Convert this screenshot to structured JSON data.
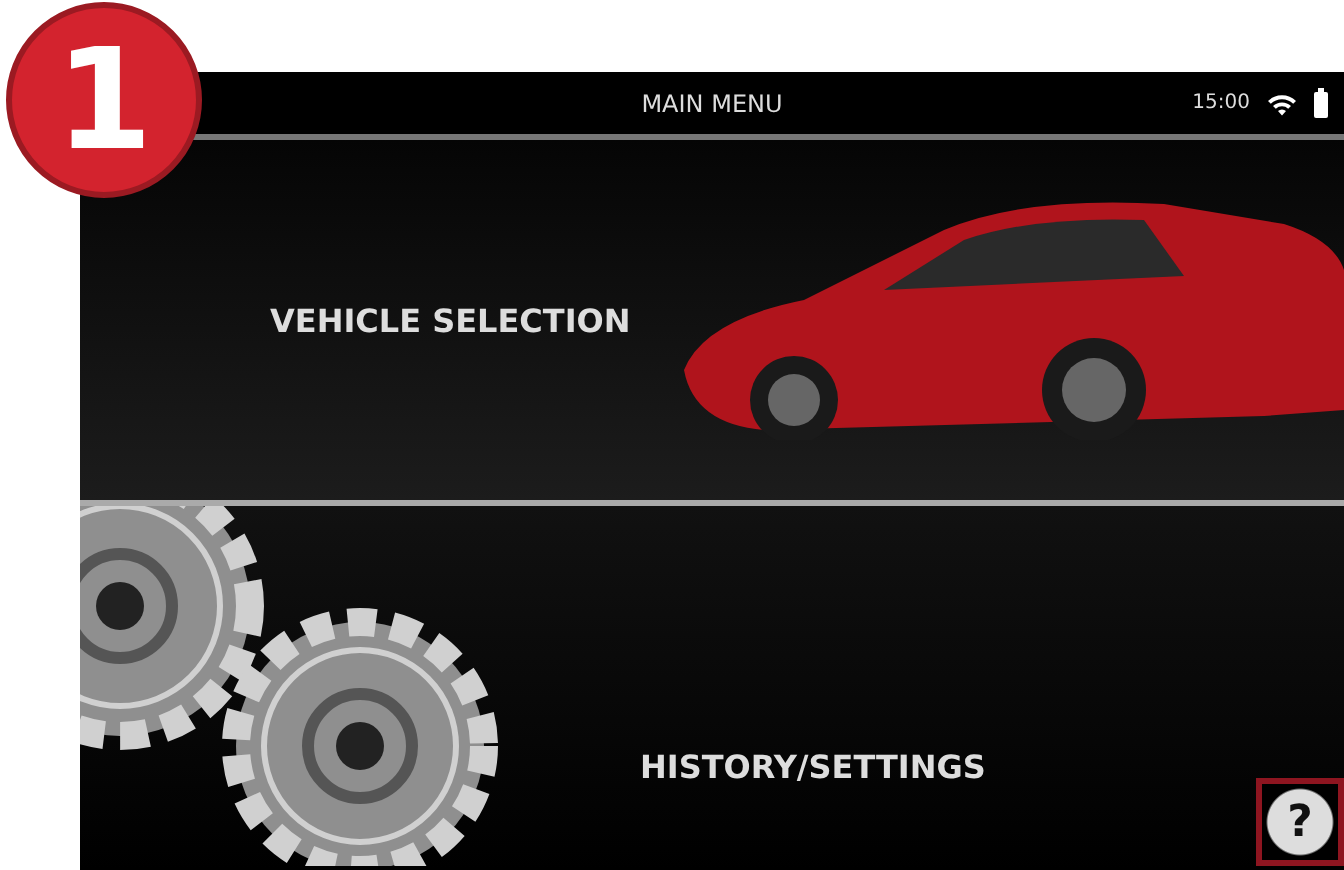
{
  "step_badge": "1",
  "status_bar": {
    "title": "MAIN MENU",
    "time": "15:00"
  },
  "menu": [
    {
      "kind": "vehicle",
      "label": "VEHICLE SELECTION"
    },
    {
      "kind": "settings",
      "label": "HISTORY/SETTINGS"
    }
  ],
  "help_button": "?"
}
